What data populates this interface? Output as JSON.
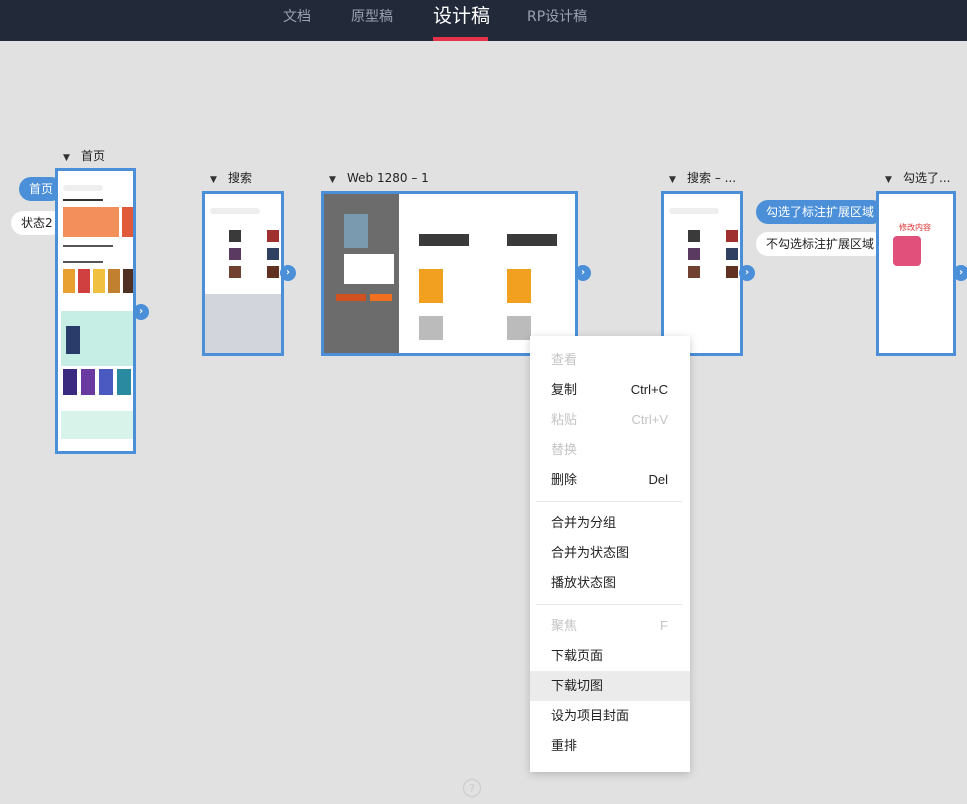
{
  "header": {
    "tabs": [
      {
        "label": "文档",
        "active": false
      },
      {
        "label": "原型稿",
        "active": false
      },
      {
        "label": "设计稿",
        "active": true
      },
      {
        "label": "RP设计稿",
        "active": false
      }
    ],
    "accent_color": "#e5334b"
  },
  "canvas": {
    "groups": [
      {
        "title": "首页"
      },
      {
        "title": "搜索"
      },
      {
        "title": "Web 1280 – 1"
      },
      {
        "title": "搜索 – ..."
      },
      {
        "title": "勾选了..."
      }
    ],
    "state_pills": {
      "home": [
        "首页",
        "状态2"
      ],
      "annotation": [
        "勾选了标注扩展区域",
        "不勾选标注扩展区域"
      ]
    },
    "board_accent": "#4a8fd8",
    "preview_text": {
      "edit_content": "修改内容"
    }
  },
  "context_menu": {
    "items": [
      {
        "label": "查看",
        "shortcut": "",
        "disabled": true
      },
      {
        "label": "复制",
        "shortcut": "Ctrl+C",
        "disabled": false
      },
      {
        "label": "粘贴",
        "shortcut": "Ctrl+V",
        "disabled": true
      },
      {
        "label": "替换",
        "shortcut": "",
        "disabled": true
      },
      {
        "label": "删除",
        "shortcut": "Del",
        "disabled": false
      },
      {
        "label": "合并为分组",
        "shortcut": "",
        "disabled": false
      },
      {
        "label": "合并为状态图",
        "shortcut": "",
        "disabled": false
      },
      {
        "label": "播放状态图",
        "shortcut": "",
        "disabled": false
      },
      {
        "label": "聚焦",
        "shortcut": "F",
        "disabled": true
      },
      {
        "label": "下载页面",
        "shortcut": "",
        "disabled": false
      },
      {
        "label": "下载切图",
        "shortcut": "",
        "disabled": false,
        "highlighted": true
      },
      {
        "label": "设为项目封面",
        "shortcut": "",
        "disabled": false
      },
      {
        "label": "重排",
        "shortcut": "",
        "disabled": false
      }
    ]
  },
  "footer": {
    "help_icon": "help-icon"
  }
}
